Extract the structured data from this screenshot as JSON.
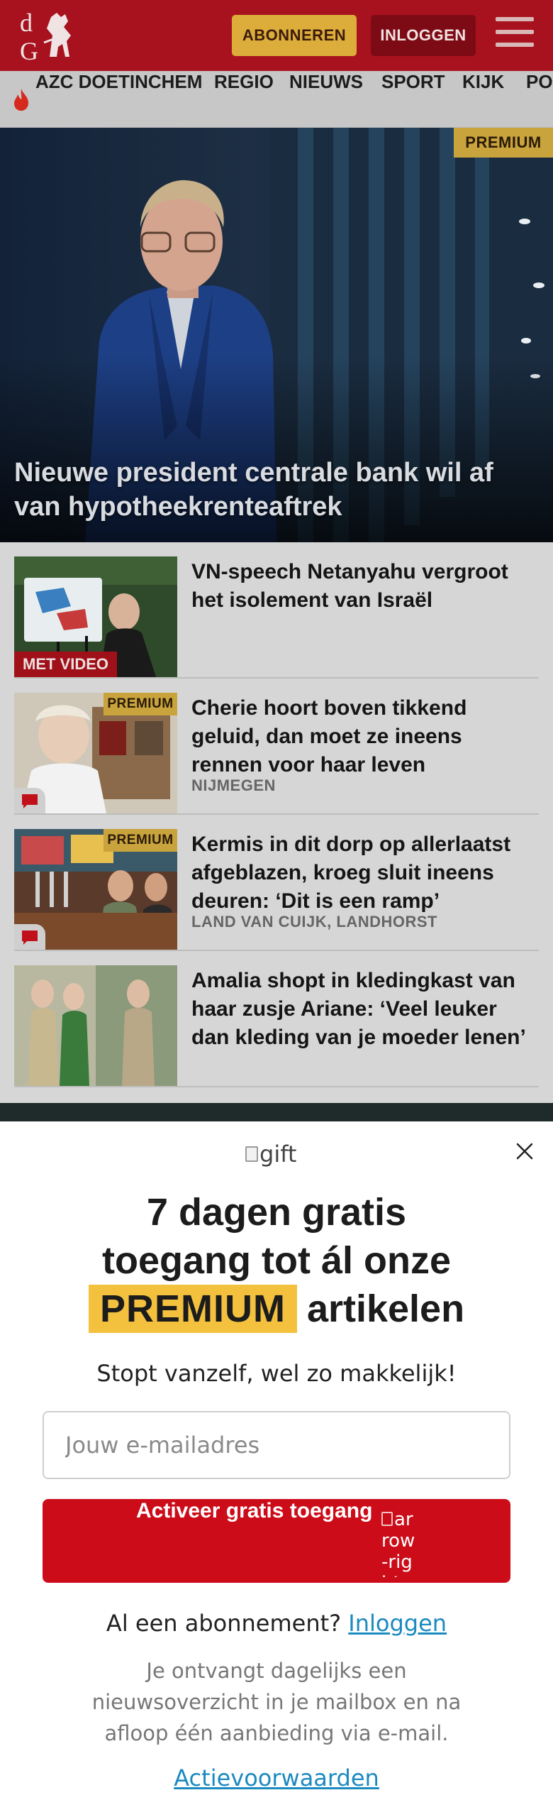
{
  "header": {
    "logo_text": "dG",
    "subscribe_label": "ABONNEREN",
    "login_label": "INLOGGEN"
  },
  "nav": {
    "items": [
      "AZC DOETINCHEM",
      "REGIO",
      "NIEUWS",
      "SPORT",
      "KIJK",
      "PO"
    ]
  },
  "hero": {
    "badge": "PREMIUM",
    "title": "Nieuwe president centrale bank wil af van hypotheekrenteaftrek"
  },
  "articles": [
    {
      "title": "VN-speech Netanyahu vergroot het isolement van Israël",
      "video_badge": "MET VIDEO"
    },
    {
      "badge": "PREMIUM",
      "title": "Cherie hoort boven tikkend geluid, dan moet ze ineens rennen voor haar leven",
      "location": "NIJMEGEN"
    },
    {
      "badge": "PREMIUM",
      "title": "Kermis in dit dorp op allerlaatst afgeblazen, kroeg sluit ineens deuren: ‘Dit is een ramp’",
      "location": "LAND VAN CUIJK, LANDHORST"
    },
    {
      "title": "Amalia shopt in kledingkast van haar zusje Ariane: ‘Veel leuker dan kleding van je moeder lenen’"
    }
  ],
  "popup": {
    "gift_alt": "gift",
    "headline_line1": "7 dagen gratis",
    "headline_line2": "toegang tot ál onze",
    "headline_premium": "PREMIUM",
    "headline_line3_end": "artikelen",
    "subheadline": "Stopt vanzelf, wel zo makkelijk!",
    "email_placeholder": "Jouw e-mailadres",
    "cta_label": "Activeer gratis toegang",
    "cta_icon_alt": "arrow-right",
    "already_text": "Al een abonnement?",
    "login_link": "Inloggen",
    "disclaimer": "Je ontvangt dagelijks een nieuwsoverzicht in je mailbox en na afloop één aanbieding via e-mail.",
    "terms_link": "Actievoorwaarden"
  },
  "colors": {
    "header_red": "#a8121e",
    "subscribe_gold": "#dcad3a",
    "cta_red": "#cc0c19",
    "premium_yellow": "#f3c13e",
    "link_blue": "#1b8ac0"
  }
}
